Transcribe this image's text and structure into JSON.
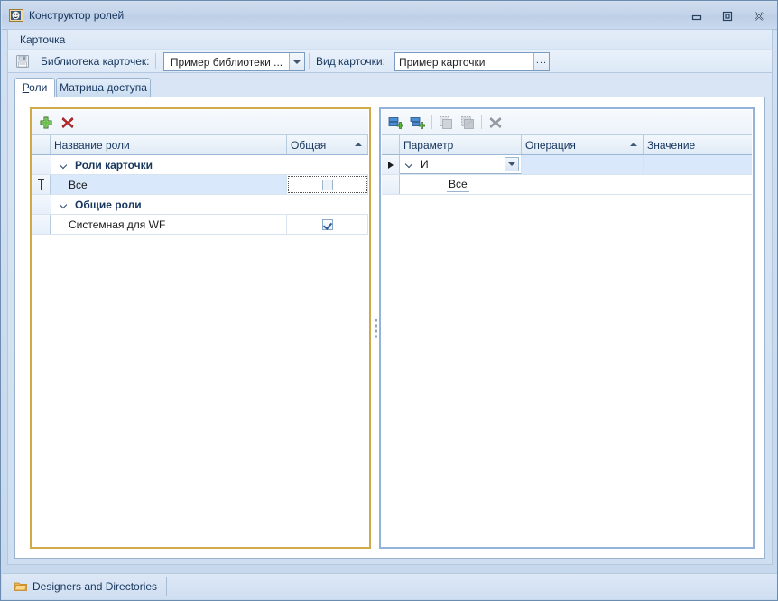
{
  "window": {
    "title": "Конструктор ролей",
    "icon": "masks-icon",
    "controls": {
      "minimize": "minimize-button",
      "maximize": "maximize-button",
      "close": "close-button"
    }
  },
  "menubar": {
    "items": [
      {
        "label": "Карточка"
      }
    ]
  },
  "toolbar": {
    "save_icon": "save-disk-icon",
    "library_label": "Библиотека карточек:",
    "library_value": "Пример библиотеки ...",
    "card_label": "Вид карточки:",
    "card_value": "Пример карточки",
    "ellipsis_label": "..."
  },
  "tabs": [
    {
      "label": "Роли",
      "accel": "Р",
      "rest": "оли",
      "active": true
    },
    {
      "label": "Матрица доступа",
      "active": false
    }
  ],
  "left_panel": {
    "toolbar": [
      {
        "name": "add-role-button",
        "icon": "plus-green-icon",
        "enabled": true
      },
      {
        "name": "delete-role-button",
        "icon": "cross-red-icon",
        "enabled": true
      }
    ],
    "columns": [
      {
        "label": "Название роли",
        "sort": ""
      },
      {
        "label": "Общая",
        "sort": "asc"
      }
    ],
    "rows": [
      {
        "type": "group",
        "label": "Роли карточки",
        "expanded": true
      },
      {
        "type": "data",
        "label": "Все",
        "checked": false,
        "selected": true,
        "cursor": "ibeam",
        "focused_cell": true
      },
      {
        "type": "group",
        "label": "Общие роли",
        "expanded": true
      },
      {
        "type": "data",
        "label": "Системная для WF",
        "checked": true,
        "selected": false
      }
    ]
  },
  "right_panel": {
    "toolbar": [
      {
        "name": "add-condition-button",
        "icon": "add-block-icon",
        "enabled": true
      },
      {
        "name": "add-group-button",
        "icon": "add-group-icon",
        "enabled": true
      },
      {
        "name": "copy-button",
        "icon": "copy-block-icon",
        "enabled": false
      },
      {
        "name": "paste-button",
        "icon": "paste-block-icon",
        "enabled": false
      },
      {
        "name": "delete-condition-button",
        "icon": "cross-gray-icon",
        "enabled": false
      }
    ],
    "columns": [
      {
        "label": "Параметр",
        "sort": ""
      },
      {
        "label": "Операция",
        "sort": "asc"
      },
      {
        "label": "Значение",
        "sort": ""
      }
    ],
    "rows": [
      {
        "type": "logic",
        "label": "И",
        "expanded": true,
        "current": true,
        "has_dropdown": true
      },
      {
        "type": "child",
        "label": "Все"
      }
    ]
  },
  "statusbar": {
    "panels": [
      {
        "label": "Designers and Directories",
        "icon": "folder-icon"
      }
    ]
  },
  "colors": {
    "window_border": "#6b8cae",
    "title_text": "#17365d",
    "client_bg": "#d4e2f3",
    "panel_focus_border": "#cfa94a",
    "panel_border": "#93b4d8",
    "row_selected": "#d9e9fb",
    "grid_header": "#e0ebf6",
    "accent_green": "#3f9b26",
    "accent_red": "#cc2222",
    "accent_blue": "#2f6bb0",
    "folder_orange": "#e8a33d"
  }
}
